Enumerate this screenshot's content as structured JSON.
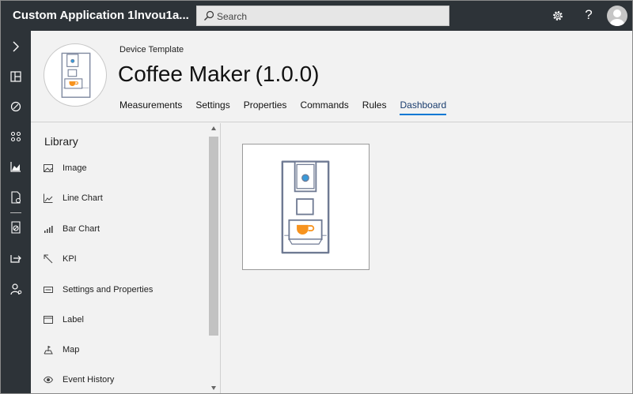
{
  "app": {
    "title": "Custom Application 1lnvou1a...",
    "search_placeholder": "Search",
    "help_glyph": "?"
  },
  "rail": {
    "icons": [
      "chevron-right-icon",
      "dashboard-icon",
      "explorer-icon",
      "device-sets-icon",
      "analytics-icon",
      "device-templates-icon",
      "rules-icon",
      "jobs-icon",
      "administration-icon"
    ]
  },
  "template": {
    "caption": "Device Template",
    "name": "Coffee Maker",
    "version": "(1.0.0)"
  },
  "tabs": [
    {
      "label": "Measurements"
    },
    {
      "label": "Settings"
    },
    {
      "label": "Properties"
    },
    {
      "label": "Commands"
    },
    {
      "label": "Rules"
    },
    {
      "label": "Dashboard",
      "active": true
    }
  ],
  "library": {
    "heading": "Library",
    "items": [
      {
        "label": "Image",
        "icon": "image-icon"
      },
      {
        "label": "Line Chart",
        "icon": "line-chart-icon"
      },
      {
        "label": "Bar Chart",
        "icon": "bar-chart-icon"
      },
      {
        "label": "KPI",
        "icon": "kpi-icon"
      },
      {
        "label": "Settings and Properties",
        "icon": "settings-properties-icon"
      },
      {
        "label": "Label",
        "icon": "label-icon"
      },
      {
        "label": "Map",
        "icon": "map-icon"
      },
      {
        "label": "Event History",
        "icon": "event-history-icon"
      }
    ]
  },
  "colors": {
    "topbar": "#2d3338",
    "accent": "#0078d4",
    "cup": "#f7931e",
    "button_dot": "#3a9ad9"
  }
}
